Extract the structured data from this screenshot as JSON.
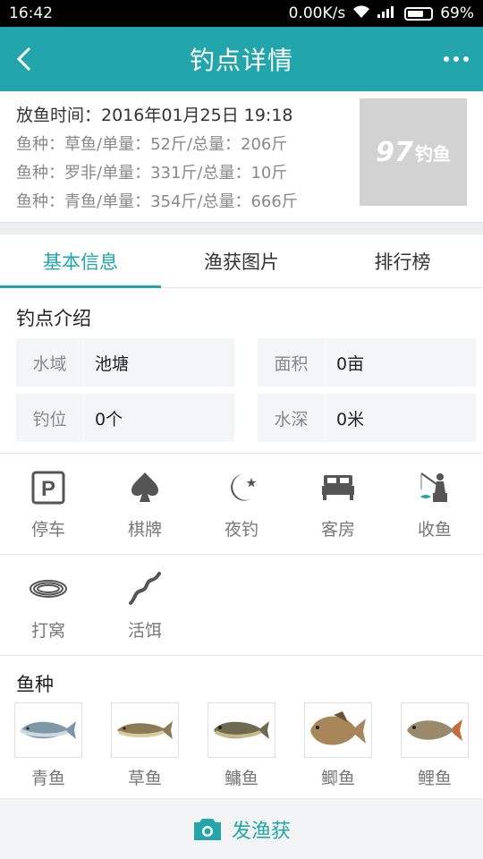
{
  "status_bar": {
    "time": "16:42",
    "speed": "0.00K/s",
    "battery": "69%"
  },
  "header": {
    "title": "钓点详情"
  },
  "release": {
    "time_text": "放鱼时间：2016年01月25日 19:18",
    "fish_lines": [
      "鱼种：草鱼/单量：52斤/总量：206斤",
      "鱼种：罗非/单量：331斤/总量：10斤",
      "鱼种：青鱼/单量：354斤/总量：666斤"
    ],
    "logo_text": "钓鱼"
  },
  "tabs": [
    {
      "label": "基本信息",
      "active": true
    },
    {
      "label": "渔获图片",
      "active": false
    },
    {
      "label": "排行榜",
      "active": false
    }
  ],
  "intro": {
    "title": "钓点介绍",
    "cells": [
      {
        "key": "水域",
        "value": "池塘"
      },
      {
        "key": "面积",
        "value": "0亩"
      },
      {
        "key": "钓位",
        "value": "0个"
      },
      {
        "key": "水深",
        "value": "0米"
      }
    ]
  },
  "facilities": [
    {
      "label": "停车",
      "icon": "parking-icon"
    },
    {
      "label": "棋牌",
      "icon": "spade-icon"
    },
    {
      "label": "夜钓",
      "icon": "moon-star-icon"
    },
    {
      "label": "客房",
      "icon": "bed-icon"
    },
    {
      "label": "收鱼",
      "icon": "fisherman-icon"
    },
    {
      "label": "打窝",
      "icon": "coil-icon"
    },
    {
      "label": "活饵",
      "icon": "worm-icon"
    }
  ],
  "species": {
    "title": "鱼种",
    "items": [
      {
        "label": "青鱼"
      },
      {
        "label": "草鱼"
      },
      {
        "label": "鳙鱼"
      },
      {
        "label": "鲫鱼"
      },
      {
        "label": "鲤鱼"
      }
    ]
  },
  "bottom": {
    "label": "发渔获"
  },
  "colors": {
    "accent": "#22a6ab"
  }
}
